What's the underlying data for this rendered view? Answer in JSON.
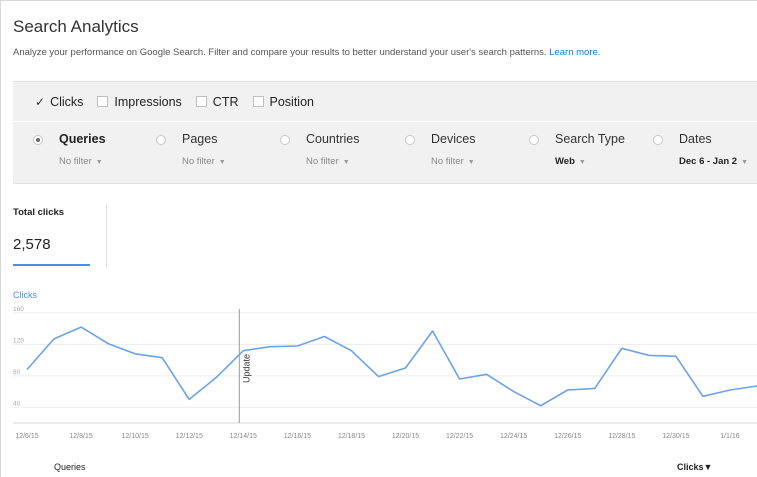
{
  "page": {
    "title": "Search Analytics",
    "subtitle": "Analyze your performance on Google Search. Filter and compare your results to better understand your user's search patterns.",
    "learn_more": "Learn more."
  },
  "metrics": [
    {
      "label": "Clicks",
      "checked": true
    },
    {
      "label": "Impressions",
      "checked": false
    },
    {
      "label": "CTR",
      "checked": false
    },
    {
      "label": "Position",
      "checked": false
    }
  ],
  "groups": [
    {
      "name": "Queries",
      "filter": "No filter",
      "selected": true
    },
    {
      "name": "Pages",
      "filter": "No filter",
      "selected": false
    },
    {
      "name": "Countries",
      "filter": "No filter",
      "selected": false
    },
    {
      "name": "Devices",
      "filter": "No filter",
      "selected": false
    },
    {
      "name": "Search Type",
      "filter": "Web",
      "selected": false
    },
    {
      "name": "Dates",
      "filter": "Dec 6 - Jan 2",
      "selected": false
    }
  ],
  "totals": {
    "label": "Total clicks",
    "value": "2,578"
  },
  "footer": {
    "left": "Queries",
    "right": "Clicks▼"
  },
  "colors": {
    "line": "#6aa3e6",
    "accent": "#4a90e2"
  },
  "chart_data": {
    "type": "line",
    "ylabel": "Clicks",
    "ylim": [
      20,
      165
    ],
    "yticks": [
      40,
      80,
      120,
      160
    ],
    "x": [
      "12/6/15",
      "12/7/15",
      "12/8/15",
      "12/9/15",
      "12/10/15",
      "12/11/15",
      "12/12/15",
      "12/13/15",
      "12/14/15",
      "12/15/15",
      "12/16/15",
      "12/17/15",
      "12/18/15",
      "12/19/15",
      "12/20/15",
      "12/21/15",
      "12/22/15",
      "12/23/15",
      "12/24/15",
      "12/25/15",
      "12/26/15",
      "12/27/15",
      "12/28/15",
      "12/29/15",
      "12/30/15",
      "12/31/15",
      "1/1/16",
      "1/2/16"
    ],
    "xtick_labels": [
      "12/6/15",
      "12/8/15",
      "12/10/15",
      "12/12/15",
      "12/14/15",
      "12/16/15",
      "12/18/15",
      "12/20/15",
      "12/22/15",
      "12/24/15",
      "12/26/15",
      "12/28/15",
      "12/30/15",
      "1/1/16"
    ],
    "series": [
      {
        "values": [
          88,
          127,
          142,
          121,
          108,
          103,
          50,
          78,
          112,
          117,
          118,
          130,
          112,
          79,
          90,
          137,
          76,
          82,
          60,
          42,
          62,
          64,
          115,
          106,
          105,
          54,
          62,
          67
        ]
      }
    ],
    "annotations": [
      {
        "x": "12/14/15",
        "label": "Update"
      }
    ],
    "grid": true
  }
}
